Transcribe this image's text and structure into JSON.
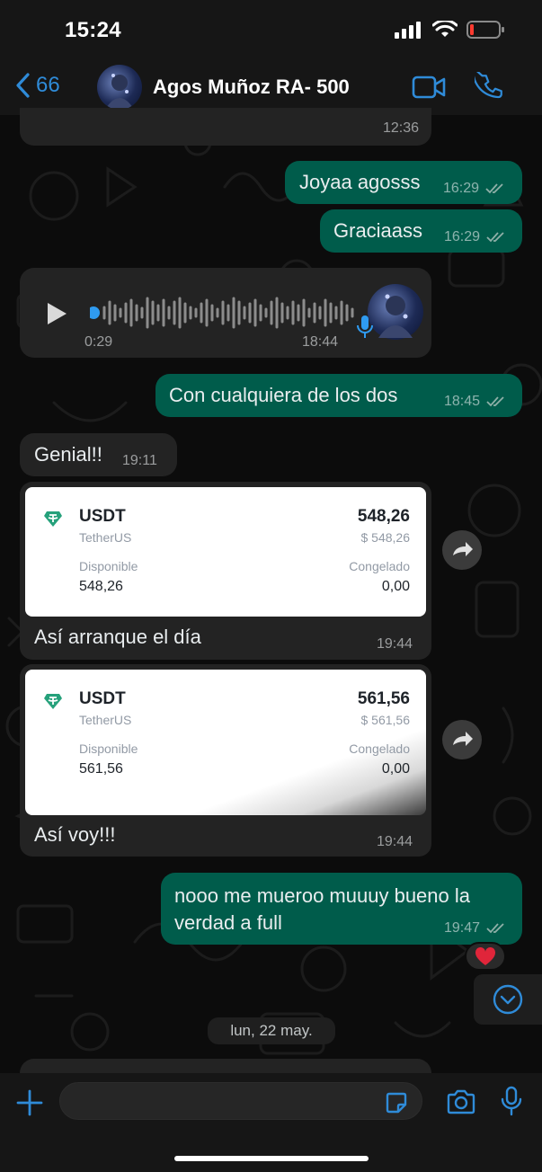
{
  "status_bar": {
    "time": "15:24"
  },
  "header": {
    "back_count": "66",
    "contact_name": "Agos Muñoz RA- 500"
  },
  "messages": [
    {
      "id": "m0",
      "direction": "in",
      "time": "12:36"
    },
    {
      "id": "m1",
      "direction": "out",
      "text": "Joyaa agosss",
      "time": "16:29"
    },
    {
      "id": "m2",
      "direction": "out",
      "text": "Graciaass",
      "time": "16:29"
    },
    {
      "id": "m3",
      "direction": "in",
      "type": "voice",
      "duration": "0:29",
      "time": "18:44"
    },
    {
      "id": "m4",
      "direction": "out",
      "text": "Con cualquiera de los dos",
      "time": "18:45"
    },
    {
      "id": "m5",
      "direction": "in",
      "text": "Genial!!",
      "time": "19:11"
    },
    {
      "id": "m6",
      "direction": "in",
      "type": "image",
      "caption": "Así arranque el día",
      "time": "19:44",
      "card": {
        "symbol": "USDT",
        "name": "TetherUS",
        "amount": "548,26",
        "fiat": "$ 548,26",
        "available_label": "Disponible",
        "available": "548,26",
        "frozen_label": "Congelado",
        "frozen": "0,00"
      }
    },
    {
      "id": "m7",
      "direction": "in",
      "type": "image",
      "caption": "Así voy!!!",
      "time": "19:44",
      "card": {
        "symbol": "USDT",
        "name": "TetherUS",
        "amount": "561,56",
        "fiat": "$ 561,56",
        "available_label": "Disponible",
        "available": "561,56",
        "frozen_label": "Congelado",
        "frozen": "0,00"
      }
    },
    {
      "id": "m8",
      "direction": "out",
      "text_line1": "nooo me mueroo muuuy bueno la",
      "text_line2": "verdad a full",
      "time": "19:47",
      "reaction": "❤️"
    }
  ],
  "date_separator": "lun, 22 may.",
  "input": {
    "value": ""
  },
  "colors": {
    "outgoing": "#005c4b",
    "incoming": "#232323",
    "accent": "#2f8bd8",
    "tether": "#26a17b"
  }
}
